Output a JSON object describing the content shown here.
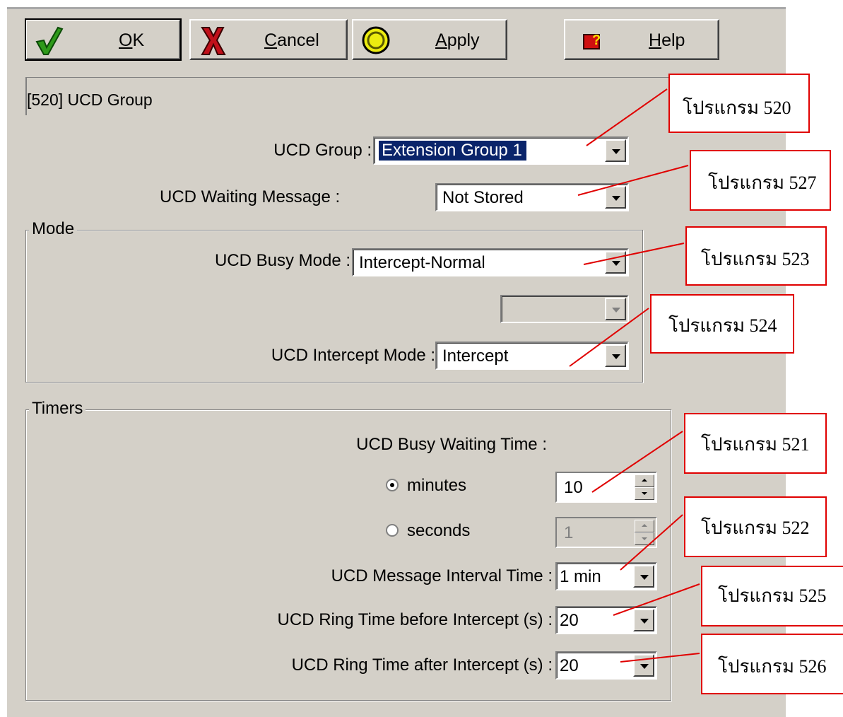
{
  "toolbar": {
    "ok": {
      "pre": "",
      "key": "O",
      "post": "K"
    },
    "cancel": {
      "pre": "",
      "key": "C",
      "post": "ancel"
    },
    "apply": {
      "pre": "",
      "key": "A",
      "post": "pply"
    },
    "help": {
      "pre": "",
      "key": "H",
      "post": "elp"
    }
  },
  "page_title": "[520] UCD Group",
  "fields": {
    "ucd_group": {
      "label": "UCD Group :",
      "value": "Extension Group  1"
    },
    "waiting_message": {
      "label": "UCD Waiting Message :",
      "value": "Not Stored"
    }
  },
  "mode": {
    "legend": "Mode",
    "busy_mode": {
      "label": "UCD Busy Mode :",
      "value": "Intercept-Normal"
    },
    "extra_select": {
      "value": ""
    },
    "intercept_mode": {
      "label": "UCD Intercept Mode :",
      "value": "Intercept"
    }
  },
  "timers": {
    "legend": "Timers",
    "busy_waiting_label": "UCD Busy Waiting Time :",
    "minutes": {
      "label": "minutes",
      "value": "10",
      "checked": true
    },
    "seconds": {
      "label": "seconds",
      "value": "1",
      "checked": false
    },
    "message_interval": {
      "label": "UCD Message Interval Time :",
      "value": "1 min"
    },
    "ring_before": {
      "label": "UCD Ring Time before Intercept (s) :",
      "value": "20"
    },
    "ring_after": {
      "label": "UCD Ring Time after Intercept (s) :",
      "value": "20"
    }
  },
  "annotations": {
    "a520": "โปรแกรม 520",
    "a527": "โปรแกรม 527",
    "a523": "โปรแกรม 523",
    "a524": "โปรแกรม 524",
    "a521": "โปรแกรม 521",
    "a522": "โปรแกรม 522",
    "a525": "โปรแกรม 525",
    "a526": "โปรแกรม 526"
  },
  "colors": {
    "dialog_bg": "#d4d0c8",
    "selection": "#0a246a",
    "annotation_border": "#e00000"
  }
}
